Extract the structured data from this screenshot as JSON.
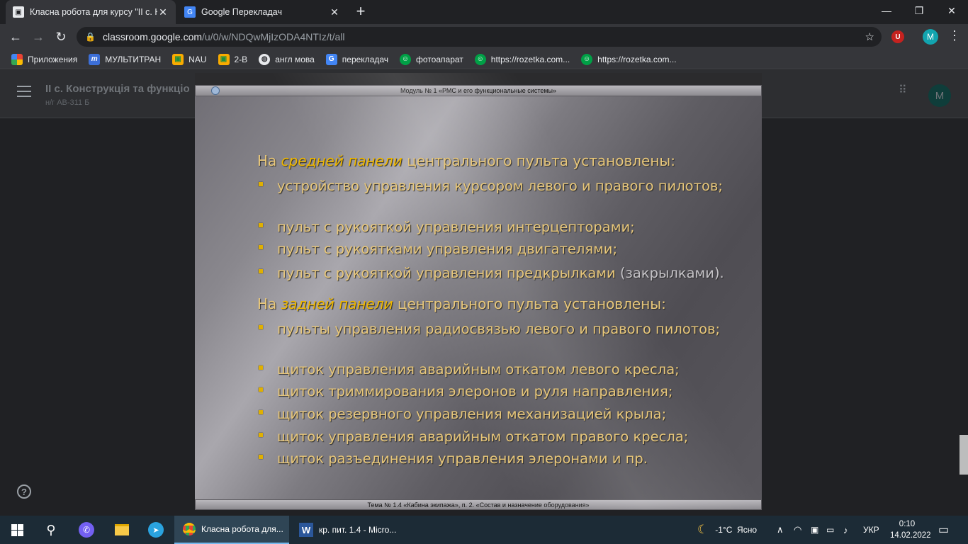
{
  "browser": {
    "tabs": [
      {
        "title": "Класна робота для курсу \"II с. К",
        "favicon": "classroom-icon"
      },
      {
        "title": "Google Перекладач",
        "favicon": "translate-icon"
      }
    ],
    "url_host": "classroom.google.com",
    "url_path": "/u/0/w/NDQwMjIzODA4NTIz/t/all",
    "profile_initial": "M",
    "ext_label": "U"
  },
  "bookmarks": [
    {
      "label": "Приложения",
      "icon": "apps-grid-icon"
    },
    {
      "label": "МУЛЬТИТРАН",
      "icon": "multitran-icon"
    },
    {
      "label": "NAU",
      "icon": "classroom-icon"
    },
    {
      "label": "2-В",
      "icon": "classroom-icon"
    },
    {
      "label": "англ мова",
      "icon": "globe-icon"
    },
    {
      "label": "перекладач",
      "icon": "translate-icon"
    },
    {
      "label": "фотоапарат",
      "icon": "rozetka-icon"
    },
    {
      "label": "https://rozetka.com...",
      "icon": "rozetka-icon"
    },
    {
      "label": "https://rozetka.com...",
      "icon": "rozetka-icon"
    }
  ],
  "classroom": {
    "course_title": "II с. Конструкція та функціо",
    "course_subtitle": "н/г АВ-311 Б",
    "avatar_initial": "M"
  },
  "slide": {
    "top_bar": "Модуль № 1     «РМС  и его функциональные системы»",
    "bottom_bar": "Тема № 1.4  «Кабина экипажа»,  п. 2. «Состав и назначение оборудования»",
    "heading1_pre": "На ",
    "heading1_em": "средней панели",
    "heading1_post": " центрального пульта установлены:",
    "group1": [
      "устройство управления курсором левого и правого пилотов;",
      "пульт с рукояткой управления интерцепторами;",
      "пульт с рукоятками управления двигателями;",
      "пульт с рукояткой управления предкрылками"
    ],
    "group1_tail": " (закрылками).",
    "heading2_pre": "На ",
    "heading2_em": "задней панели",
    "heading2_post": " центрального пульта установлены:",
    "group2": [
      "пульты управления радиосвязью левого и правого пилотов;",
      "щиток управления аварийным откатом левого кресла;",
      "щиток триммирования элеронов и руля направления;",
      "щиток резервного управления механизацией крыла;",
      "щиток управления аварийным откатом правого кресла;",
      "щиток разъединения управления элеронами и пр."
    ]
  },
  "taskbar": {
    "apps": [
      {
        "label": "Класна робота для...",
        "icon": "chrome-icon"
      },
      {
        "label": "кр. пит. 1.4 - Micro...",
        "icon": "word-icon"
      }
    ],
    "weather": "-1°C  Ясно",
    "language": "УКР",
    "time": "0:10",
    "date": "14.02.2022"
  },
  "colors": {
    "accent": "#f0b800",
    "text": "#e8c77a",
    "taskbar": "#1c2b36"
  }
}
